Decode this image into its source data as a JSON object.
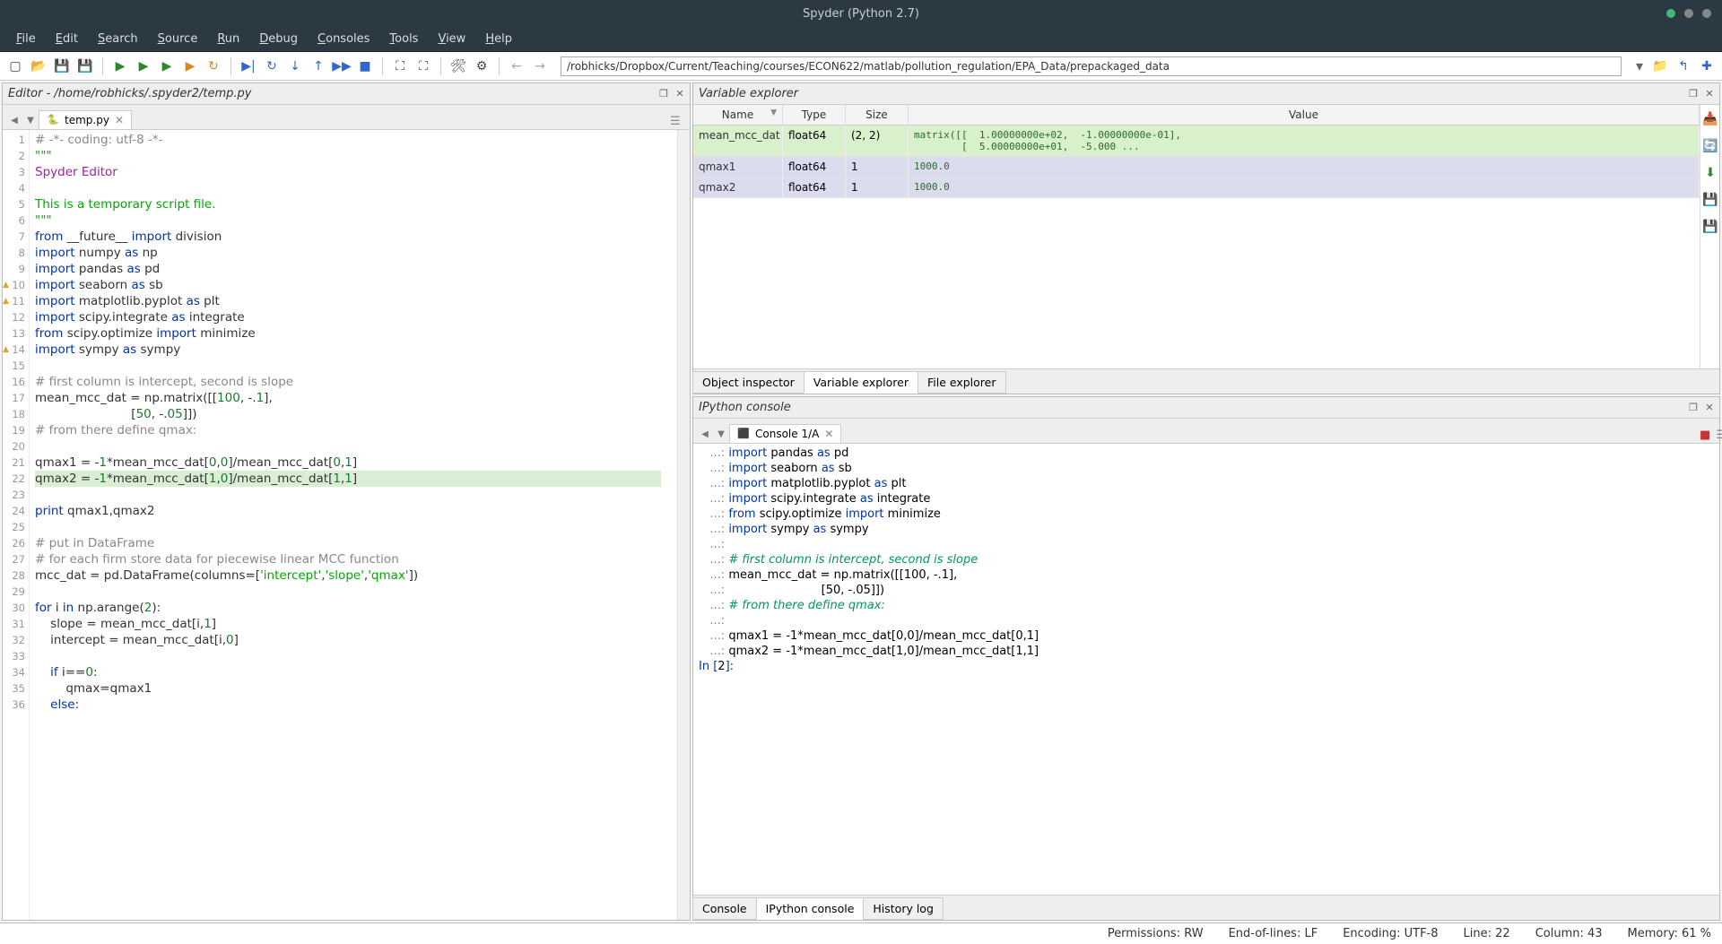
{
  "window": {
    "title": "Spyder (Python 2.7)"
  },
  "menus": [
    "File",
    "Edit",
    "Search",
    "Source",
    "Run",
    "Debug",
    "Consoles",
    "Tools",
    "View",
    "Help"
  ],
  "path": "/robhicks/Dropbox/Current/Teaching/courses/ECON622/matlab/pollution_regulation/EPA_Data/prepackaged_data",
  "editor": {
    "header": "Editor - /home/robhicks/.spyder2/temp.py",
    "tab": "temp.py"
  },
  "code_lines": [
    {
      "n": 1,
      "seg": [
        [
          "com",
          "# -*- coding: utf-8 -*-"
        ]
      ]
    },
    {
      "n": 2,
      "seg": [
        [
          "str",
          "\"\"\""
        ]
      ]
    },
    {
      "n": 3,
      "seg": [
        [
          "cls",
          "Spyder Editor"
        ]
      ]
    },
    {
      "n": 4,
      "seg": [
        [
          "",
          ""
        ]
      ]
    },
    {
      "n": 5,
      "seg": [
        [
          "str",
          "This is a temporary script file."
        ]
      ]
    },
    {
      "n": 6,
      "seg": [
        [
          "str",
          "\"\"\""
        ]
      ]
    },
    {
      "n": 7,
      "seg": [
        [
          "kw",
          "from "
        ],
        [
          "",
          "__future__ "
        ],
        [
          "kw",
          "import "
        ],
        [
          "",
          "division"
        ]
      ]
    },
    {
      "n": 8,
      "seg": [
        [
          "kw",
          "import "
        ],
        [
          "",
          "numpy "
        ],
        [
          "kw",
          "as "
        ],
        [
          "",
          "np"
        ]
      ]
    },
    {
      "n": 9,
      "seg": [
        [
          "kw",
          "import "
        ],
        [
          "",
          "pandas "
        ],
        [
          "kw",
          "as "
        ],
        [
          "",
          "pd"
        ]
      ]
    },
    {
      "n": 10,
      "warn": true,
      "seg": [
        [
          "kw",
          "import "
        ],
        [
          "",
          "seaborn "
        ],
        [
          "kw",
          "as "
        ],
        [
          "",
          "sb"
        ]
      ]
    },
    {
      "n": 11,
      "warn": true,
      "seg": [
        [
          "kw",
          "import "
        ],
        [
          "",
          "matplotlib.pyplot "
        ],
        [
          "kw",
          "as "
        ],
        [
          "",
          "plt"
        ]
      ]
    },
    {
      "n": 12,
      "seg": [
        [
          "kw",
          "import "
        ],
        [
          "",
          "scipy.integrate "
        ],
        [
          "kw",
          "as "
        ],
        [
          "",
          "integrate"
        ]
      ]
    },
    {
      "n": 13,
      "seg": [
        [
          "kw",
          "from "
        ],
        [
          "",
          "scipy.optimize "
        ],
        [
          "kw",
          "import "
        ],
        [
          "",
          "minimize"
        ]
      ]
    },
    {
      "n": 14,
      "warn": true,
      "seg": [
        [
          "kw",
          "import "
        ],
        [
          "",
          "sympy "
        ],
        [
          "kw",
          "as "
        ],
        [
          "",
          "sympy"
        ]
      ]
    },
    {
      "n": 15,
      "seg": [
        [
          "",
          ""
        ]
      ]
    },
    {
      "n": 16,
      "seg": [
        [
          "com",
          "# first column is intercept, second is slope"
        ]
      ]
    },
    {
      "n": 17,
      "seg": [
        [
          "",
          "mean_mcc_dat = np.matrix([["
        ],
        [
          "num",
          "100"
        ],
        [
          "",
          ", -."
        ],
        [
          "num",
          "1"
        ],
        [
          "",
          "],"
        ]
      ]
    },
    {
      "n": 18,
      "seg": [
        [
          "",
          "                         ["
        ],
        [
          "num",
          "50"
        ],
        [
          "",
          ", -."
        ],
        [
          "num",
          "05"
        ],
        [
          "",
          "]])"
        ]
      ]
    },
    {
      "n": 19,
      "seg": [
        [
          "com",
          "# from there define qmax:"
        ]
      ]
    },
    {
      "n": 20,
      "seg": [
        [
          "",
          ""
        ]
      ]
    },
    {
      "n": 21,
      "seg": [
        [
          "",
          "qmax1 = -"
        ],
        [
          "num",
          "1"
        ],
        [
          "",
          "*mean_mcc_dat["
        ],
        [
          "num",
          "0"
        ],
        [
          "",
          ","
        ],
        [
          "num",
          "0"
        ],
        [
          "",
          "]/mean_mcc_dat["
        ],
        [
          "num",
          "0"
        ],
        [
          "",
          ","
        ],
        [
          "num",
          "1"
        ],
        [
          "",
          "]"
        ]
      ]
    },
    {
      "n": 22,
      "hl": true,
      "seg": [
        [
          "",
          "qmax2 = -"
        ],
        [
          "num",
          "1"
        ],
        [
          "",
          "*mean_mcc_dat["
        ],
        [
          "num",
          "1"
        ],
        [
          "",
          ","
        ],
        [
          "num",
          "0"
        ],
        [
          "",
          "]/mean_mcc_dat["
        ],
        [
          "num",
          "1"
        ],
        [
          "",
          ","
        ],
        [
          "num",
          "1"
        ],
        [
          "",
          "]"
        ]
      ]
    },
    {
      "n": 23,
      "seg": [
        [
          "",
          ""
        ]
      ]
    },
    {
      "n": 24,
      "seg": [
        [
          "kw",
          "print "
        ],
        [
          "",
          "qmax1,qmax2"
        ]
      ]
    },
    {
      "n": 25,
      "seg": [
        [
          "",
          ""
        ]
      ]
    },
    {
      "n": 26,
      "seg": [
        [
          "com",
          "# put in DataFrame"
        ]
      ]
    },
    {
      "n": 27,
      "seg": [
        [
          "com",
          "# for each firm store data for piecewise linear MCC function"
        ]
      ]
    },
    {
      "n": 28,
      "seg": [
        [
          "",
          "mcc_dat = pd.DataFrame(columns=["
        ],
        [
          "str",
          "'intercept'"
        ],
        [
          "",
          ","
        ],
        [
          "str",
          "'slope'"
        ],
        [
          "",
          ","
        ],
        [
          "str",
          "'qmax'"
        ],
        [
          "",
          "])"
        ]
      ]
    },
    {
      "n": 29,
      "seg": [
        [
          "",
          ""
        ]
      ]
    },
    {
      "n": 30,
      "seg": [
        [
          "kw",
          "for "
        ],
        [
          "",
          "i "
        ],
        [
          "kw",
          "in "
        ],
        [
          "",
          "np.arange("
        ],
        [
          "num",
          "2"
        ],
        [
          "",
          "):"
        ]
      ]
    },
    {
      "n": 31,
      "seg": [
        [
          "",
          "    slope = mean_mcc_dat[i,"
        ],
        [
          "num",
          "1"
        ],
        [
          "",
          "]"
        ]
      ]
    },
    {
      "n": 32,
      "seg": [
        [
          "",
          "    intercept = mean_mcc_dat[i,"
        ],
        [
          "num",
          "0"
        ],
        [
          "",
          "]"
        ]
      ]
    },
    {
      "n": 33,
      "seg": [
        [
          "",
          ""
        ]
      ]
    },
    {
      "n": 34,
      "seg": [
        [
          "",
          "    "
        ],
        [
          "kw",
          "if "
        ],
        [
          "",
          "i=="
        ],
        [
          "num",
          "0"
        ],
        [
          "",
          ":"
        ]
      ]
    },
    {
      "n": 35,
      "seg": [
        [
          "",
          "        qmax=qmax1"
        ]
      ]
    },
    {
      "n": 36,
      "seg": [
        [
          "",
          "    "
        ],
        [
          "kw",
          "else"
        ],
        [
          "",
          ":"
        ]
      ]
    }
  ],
  "varexp": {
    "header": "Variable explorer",
    "cols": [
      "Name",
      "Type",
      "Size",
      "Value"
    ],
    "rows": [
      {
        "name": "mean_mcc_dat",
        "type": "float64",
        "size": "(2, 2)",
        "value": "matrix([[  1.00000000e+02,  -1.00000000e-01],\n        [  5.00000000e+01,  -5.000 ...",
        "class": "row-green"
      },
      {
        "name": "qmax1",
        "type": "float64",
        "size": "1",
        "value": "1000.0",
        "class": "row-purple"
      },
      {
        "name": "qmax2",
        "type": "float64",
        "size": "1",
        "value": "1000.0",
        "class": "row-purple"
      }
    ],
    "tabs": [
      "Object inspector",
      "Variable explorer",
      "File explorer"
    ]
  },
  "console": {
    "header": "IPython console",
    "tab": "Console 1/A",
    "tabs": [
      "Console",
      "IPython console",
      "History log"
    ],
    "lines": [
      [
        [
          "pr",
          "   ...: "
        ],
        [
          "cimp",
          "import "
        ],
        [
          "",
          "pandas "
        ],
        [
          "cimp",
          "as "
        ],
        [
          "",
          "pd"
        ]
      ],
      [
        [
          "pr",
          "   ...: "
        ],
        [
          "cimp",
          "import "
        ],
        [
          "",
          "seaborn "
        ],
        [
          "cimp",
          "as "
        ],
        [
          "",
          "sb"
        ]
      ],
      [
        [
          "pr",
          "   ...: "
        ],
        [
          "cimp",
          "import "
        ],
        [
          "",
          "matplotlib.pyplot "
        ],
        [
          "cimp",
          "as "
        ],
        [
          "",
          "plt"
        ]
      ],
      [
        [
          "pr",
          "   ...: "
        ],
        [
          "cimp",
          "import "
        ],
        [
          "",
          "scipy.integrate "
        ],
        [
          "cimp",
          "as "
        ],
        [
          "",
          "integrate"
        ]
      ],
      [
        [
          "pr",
          "   ...: "
        ],
        [
          "cimp",
          "from "
        ],
        [
          "",
          "scipy.optimize "
        ],
        [
          "cimp",
          "import "
        ],
        [
          "",
          "minimize"
        ]
      ],
      [
        [
          "pr",
          "   ...: "
        ],
        [
          "cimp",
          "import "
        ],
        [
          "",
          "sympy "
        ],
        [
          "cimp",
          "as "
        ],
        [
          "",
          "sympy"
        ]
      ],
      [
        [
          "pr",
          "   ...: "
        ]
      ],
      [
        [
          "pr",
          "   ...: "
        ],
        [
          "ccom",
          "# first column is intercept, second is slope"
        ]
      ],
      [
        [
          "pr",
          "   ...: "
        ],
        [
          "",
          "mean_mcc_dat = np.matrix([[100, -.1],"
        ]
      ],
      [
        [
          "pr",
          "   ...: "
        ],
        [
          "",
          "                         [50, -.05]])"
        ]
      ],
      [
        [
          "pr",
          "   ...: "
        ],
        [
          "ccom",
          "# from there define qmax:"
        ]
      ],
      [
        [
          "pr",
          "   ...: "
        ]
      ],
      [
        [
          "pr",
          "   ...: "
        ],
        [
          "",
          "qmax1 = -1*mean_mcc_dat[0,0]/mean_mcc_dat[0,1]"
        ]
      ],
      [
        [
          "pr",
          "   ...: "
        ],
        [
          "",
          "qmax2 = -1*mean_mcc_dat[1,0]/mean_mcc_dat[1,1]"
        ]
      ],
      [
        [
          "",
          ""
        ]
      ],
      [
        [
          "cimp",
          "In ["
        ],
        [
          "",
          "2"
        ],
        [
          "cimp",
          "]: "
        ]
      ]
    ]
  },
  "status": {
    "perm": "Permissions: RW",
    "eol": "End-of-lines: LF",
    "enc": "Encoding: UTF-8",
    "line": "Line: 22",
    "col": "Column: 43",
    "mem": "Memory: 61 %"
  }
}
